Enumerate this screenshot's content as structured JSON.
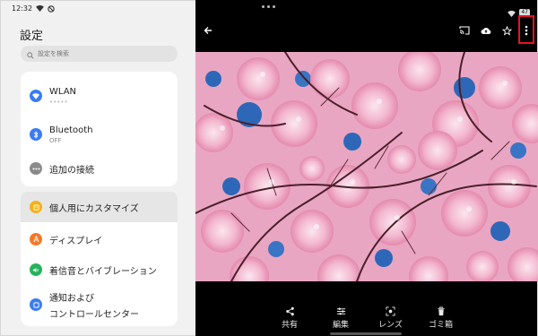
{
  "status": {
    "time": "12:32",
    "battery": "47"
  },
  "settings": {
    "title": "設定",
    "search_placeholder": "設定を検索",
    "items": [
      {
        "label": "WLAN",
        "sub": "•••••",
        "icon": "wifi-icon",
        "color": "#3b7cf5"
      },
      {
        "label": "Bluetooth",
        "sub": "OFF",
        "icon": "bluetooth-icon",
        "color": "#3b7cf5"
      },
      {
        "label": "追加の接続",
        "icon": "more-connections-icon",
        "color": "#8a8a8a"
      },
      {
        "label": "個人用にカスタマイズ",
        "icon": "customize-icon",
        "color": "#f2b21a"
      },
      {
        "label": "ディスプレイ",
        "icon": "display-icon",
        "color": "#f07a2a"
      },
      {
        "label": "着信音とバイブレーション",
        "icon": "sound-icon",
        "color": "#26b35c"
      },
      {
        "label": "通知および",
        "label2": "コントロールセンター",
        "icon": "notification-icon",
        "color": "#3b7cf5"
      }
    ]
  },
  "viewer": {
    "actions": [
      {
        "label": "共有",
        "icon": "share-icon"
      },
      {
        "label": "編集",
        "icon": "edit-icon"
      },
      {
        "label": "レンズ",
        "icon": "lens-icon"
      },
      {
        "label": "ゴミ箱",
        "icon": "trash-icon"
      }
    ],
    "accent_highlight": "#e6141e"
  }
}
